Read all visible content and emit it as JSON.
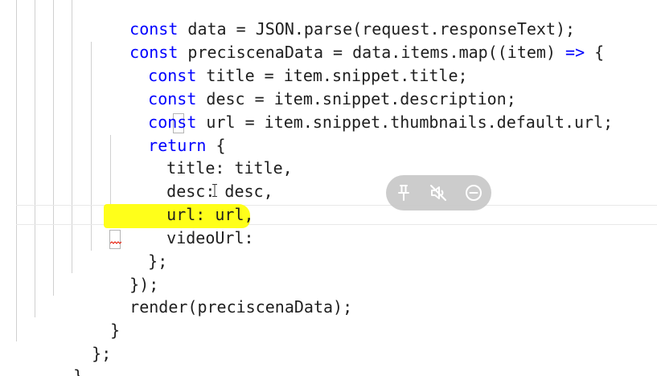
{
  "editor": {
    "lines": [
      {
        "kw": "const",
        "text": " data = JSON.parse(request.responseText);"
      },
      {
        "kw": "const",
        "text": " preciscenaData = data.items.map((item) ",
        "kw2": "=>",
        "text2": " {"
      },
      {
        "kw": "const",
        "text": " title = item.snippet.title;"
      },
      {
        "kw": "const",
        "text": " desc = item.snippet.description;"
      },
      {
        "kw": "const",
        "text": " url = item.snippet.thumbnails.default.url;"
      },
      {
        "kw": "return",
        "text": " {"
      },
      {
        "text": "title: title,"
      },
      {
        "text": "desc: desc,"
      },
      {
        "text": "url: url,"
      },
      {
        "text": "videoUrl:"
      },
      {
        "text": "};"
      },
      {
        "text": "});"
      },
      {
        "text": "render(preciscenaData);"
      },
      {
        "text": "}"
      },
      {
        "text": "};"
      },
      {
        "text": "}"
      }
    ]
  },
  "overlay_toolbar": {
    "buttons": [
      {
        "icon": "pin-icon"
      },
      {
        "icon": "mute-icon"
      },
      {
        "icon": "minus-circle-icon"
      }
    ],
    "colors": {
      "background": "#c7c7c7",
      "icon": "#ffffff"
    }
  },
  "colors": {
    "keyword": "#0000ff",
    "text": "#1f1f1f",
    "highlight": "#ffff1a",
    "indent_guide": "#d0d0d0"
  }
}
